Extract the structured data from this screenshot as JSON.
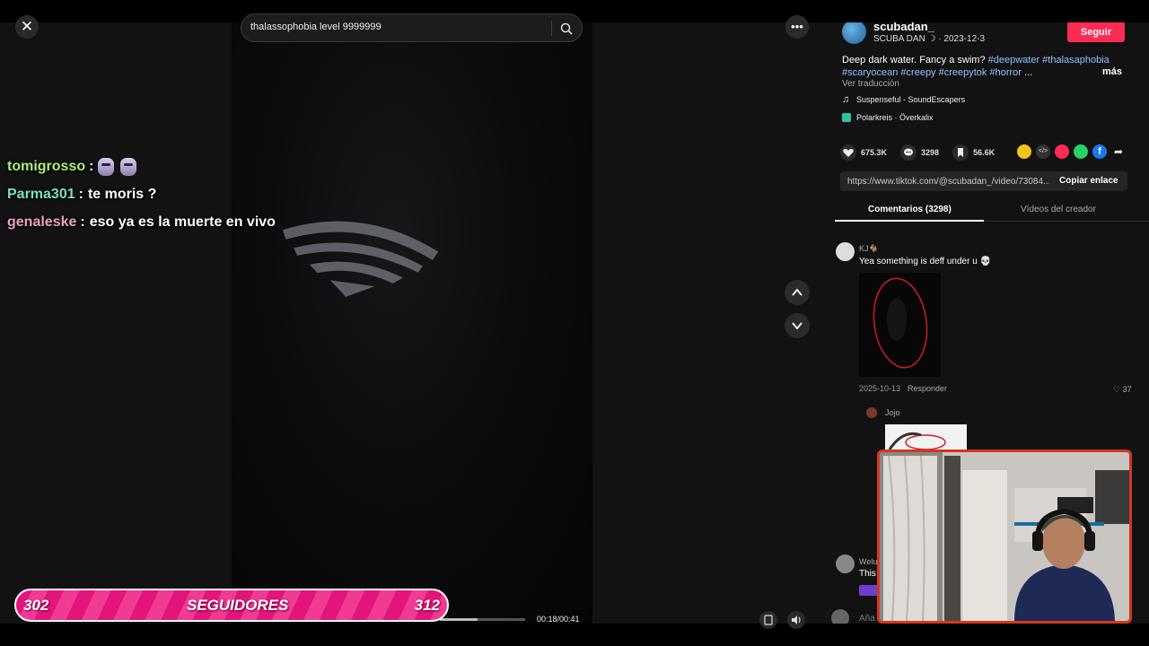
{
  "search": {
    "value": "thalassophobia level 9999999"
  },
  "icons": {
    "close": "close-icon",
    "search": "search-icon",
    "more": "more-options-icon",
    "up": "chevron-up-icon",
    "down": "chevron-down-icon"
  },
  "chat": [
    {
      "user": "tomigrosso",
      "colon": ":",
      "text": "",
      "user_color": "#a8f07a",
      "emotes": 2
    },
    {
      "user": "Parma301",
      "colon": ":",
      "text": "te moris ?",
      "user_color": "#7be0c8",
      "emotes": 0
    },
    {
      "user": "genaleske",
      "colon": ":",
      "text": "eso ya es la muerte en vivo",
      "user_color": "#f0a0c8",
      "emotes": 0
    }
  ],
  "player": {
    "time": "00:18/00:41",
    "progress": 0.44
  },
  "follow_goal": {
    "current": "302",
    "label": "SEGUIDORES",
    "target": "312",
    "fraction": 0.0
  },
  "author": {
    "name": "scubadan_",
    "sub": "SCUBA DAN",
    "date": "· 2023-12-3",
    "follow_label": "Seguir"
  },
  "description": {
    "text": "Deep dark water. Fancy a swim? ",
    "tags_line1": "#deepwater #thalasaphobia",
    "tags_line2": "#scaryocean #creepy #creepytok #horror",
    "ellipsis": " ...",
    "more": "más",
    "translate": "Ver traducción"
  },
  "music": "Suspenseful - SoundEscapers",
  "effect": "Polarkreis · Överkalix",
  "stats": {
    "likes": "675.3K",
    "comments": "3298",
    "saves": "56.6K"
  },
  "link": {
    "url": "https://www.tiktok.com/@scubadan_/video/73084...",
    "copy": "Copiar enlace"
  },
  "tabs": {
    "comments": "Comentarios (3298)",
    "videos": "Vídeos del creador"
  },
  "comments": [
    {
      "user": "KJ🐐",
      "text": "Yea something is deff under u 💀",
      "date": "2025-10-13",
      "reply": "Responder",
      "likes": "37"
    },
    {
      "user": "Jojo"
    },
    {
      "user": "Welu",
      "text": "This"
    }
  ],
  "comment_input": {
    "placeholder": "Aña"
  },
  "colors": {
    "accent": "#fe2c55",
    "follow_bar": "#e3147a",
    "webcam_border": "#d4361f"
  }
}
